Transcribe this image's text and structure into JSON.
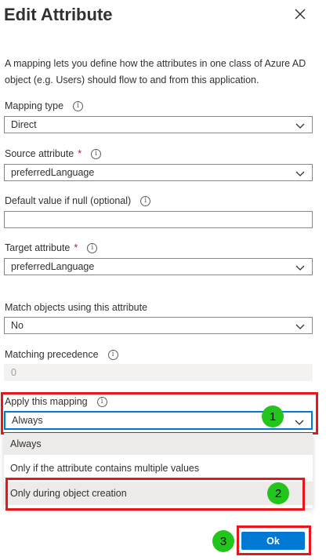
{
  "header": {
    "title": "Edit Attribute",
    "close_icon": "close-icon"
  },
  "description": "A mapping lets you define how the attributes in one class of Azure AD object (e.g. Users) should flow to and from this application.",
  "fields": {
    "mapping_type": {
      "label": "Mapping type",
      "value": "Direct"
    },
    "source_attribute": {
      "label": "Source attribute",
      "required_mark": "*",
      "value": "preferredLanguage"
    },
    "default_value": {
      "label": "Default value if null (optional)",
      "value": ""
    },
    "target_attribute": {
      "label": "Target attribute",
      "required_mark": "*",
      "value": "preferredLanguage"
    },
    "match_objects": {
      "label": "Match objects using this attribute",
      "value": "No"
    },
    "matching_precedence": {
      "label": "Matching precedence",
      "value": "0"
    },
    "apply_mapping": {
      "label": "Apply this mapping",
      "value": "Always",
      "options": [
        "Always",
        "Only if the attribute contains multiple values",
        "Only during object creation"
      ]
    }
  },
  "info_glyph": "i",
  "annotations": {
    "badge1": "1",
    "badge2": "2",
    "badge3": "3",
    "highlight_color": "#e8151b",
    "badge_color": "#22c51c"
  },
  "footer": {
    "ok_label": "Ok"
  },
  "colors": {
    "accent": "#0078d4",
    "required": "#a4262c"
  }
}
